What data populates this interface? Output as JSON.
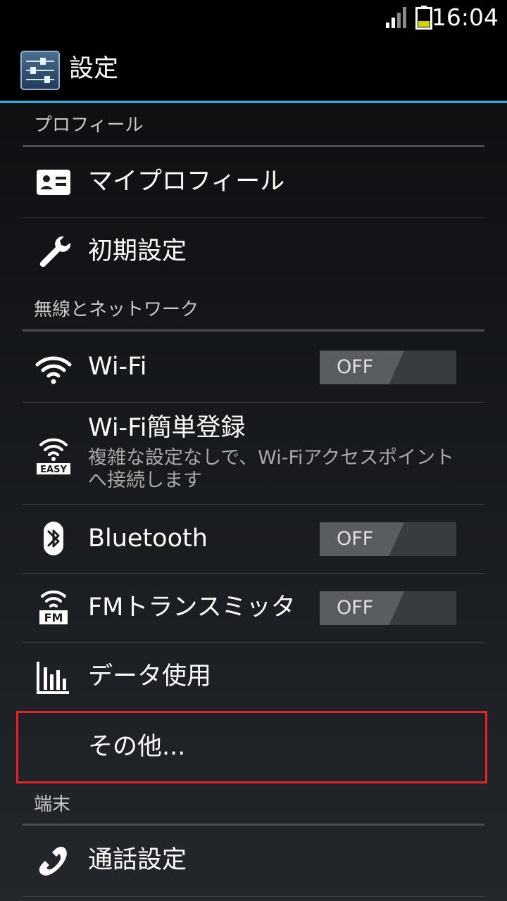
{
  "status_bar": {
    "time": "16:04",
    "signal_icon": "signal-icon",
    "battery_icon": "battery-icon",
    "battery_color": "#d4d400"
  },
  "action_bar": {
    "title": "設定",
    "icon": "settings-sliders-icon",
    "divider_color": "#33b5e5"
  },
  "sections": {
    "profile": {
      "header": "プロフィール",
      "items": {
        "my_profile": {
          "label": "マイプロフィール",
          "icon": "profile-card-icon"
        },
        "initial_setup": {
          "label": "初期設定",
          "icon": "wrench-icon"
        }
      }
    },
    "wireless": {
      "header": "無線とネットワーク",
      "items": {
        "wifi": {
          "label": "Wi-Fi",
          "icon": "wifi-icon",
          "toggle": "OFF"
        },
        "wifi_easy": {
          "label": "Wi-Fi簡単登録",
          "summary": "複雑な設定なしで、Wi-Fiアクセスポイントへ接続します",
          "icon": "wifi-easy-icon",
          "icon_text": "EASY"
        },
        "bluetooth": {
          "label": "Bluetooth",
          "icon": "bluetooth-icon",
          "toggle": "OFF"
        },
        "fm": {
          "label": "FMトランスミッタ",
          "icon": "fm-transmitter-icon",
          "icon_text": "FM",
          "toggle": "OFF"
        },
        "data_usage": {
          "label": "データ使用",
          "icon": "bar-chart-icon"
        },
        "more": {
          "label": "その他..."
        }
      }
    },
    "device": {
      "header": "端末",
      "items": {
        "call_settings": {
          "label": "通話設定",
          "icon": "phone-icon"
        }
      }
    }
  },
  "highlight_color": "#e8202a"
}
